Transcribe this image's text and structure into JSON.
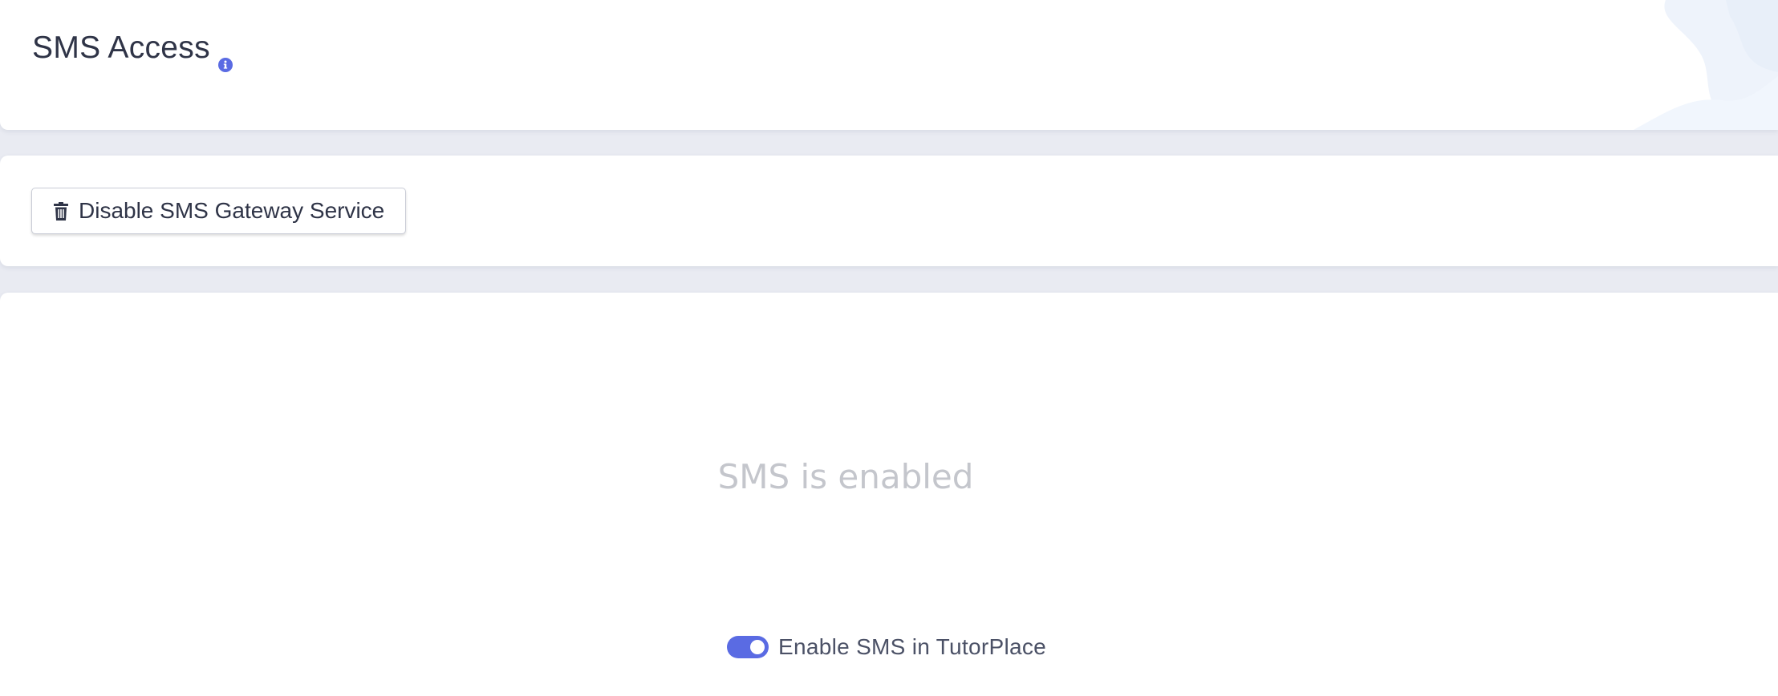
{
  "header": {
    "title": "SMS Access",
    "info_icon": "info-icon"
  },
  "toolbar": {
    "disable_button_label": "Disable SMS Gateway Service",
    "disable_button_icon": "trash-icon"
  },
  "content": {
    "status_text": "SMS is enabled",
    "toggle": {
      "label": "Enable SMS in TutorPlace",
      "checked": true
    }
  },
  "colors": {
    "accent": "#5a6be3",
    "background": "#e9ebf2",
    "card": "#ffffff",
    "text": "#2f3447",
    "muted_text": "#c4c6cc"
  }
}
